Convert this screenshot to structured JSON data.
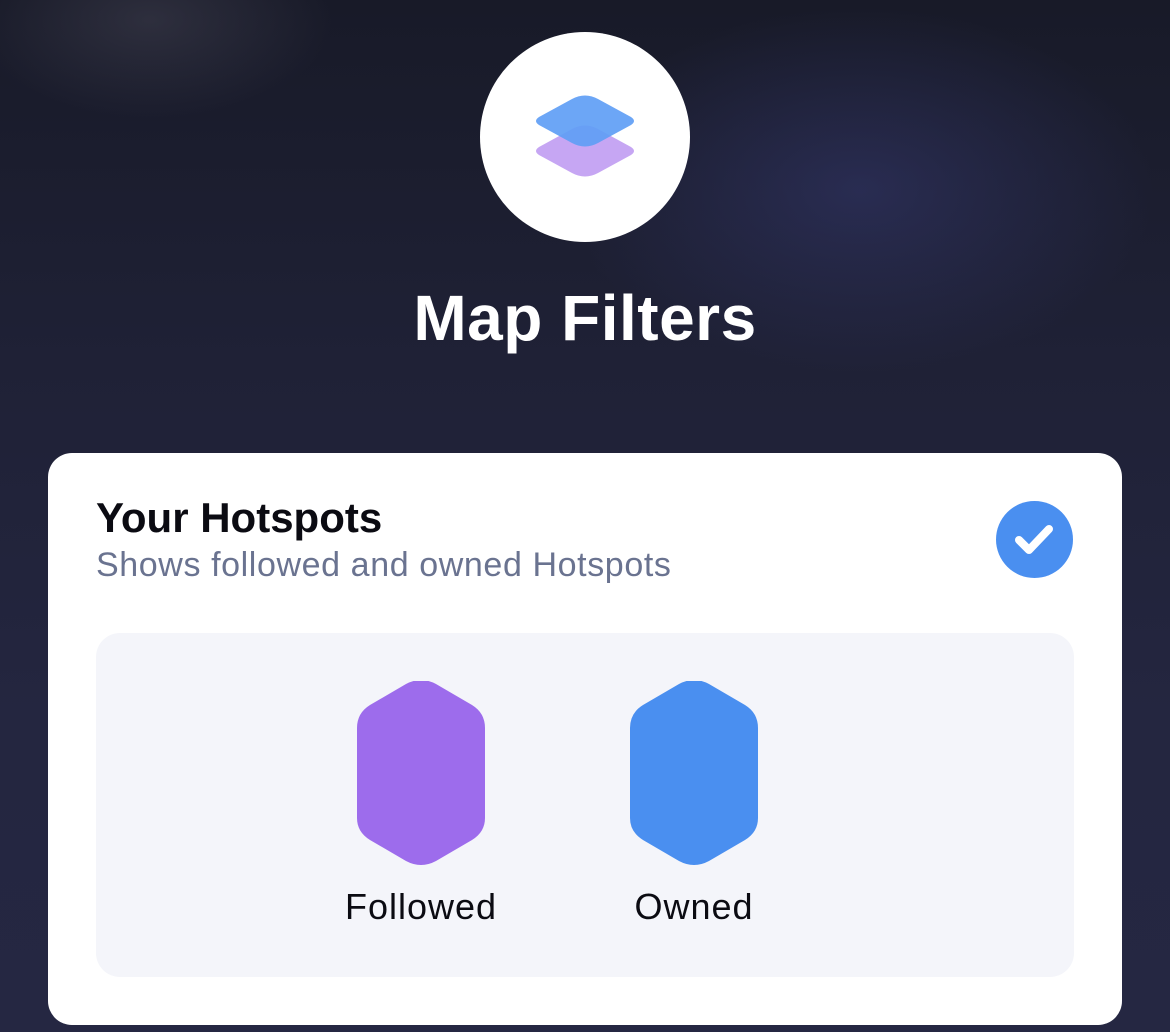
{
  "header": {
    "icon": "layers-icon",
    "title": "Map Filters"
  },
  "filter": {
    "title": "Your Hotspots",
    "subtitle": "Shows followed and owned Hotspots",
    "checked": true,
    "check_icon": "checkmark-icon",
    "legend": [
      {
        "label": "Followed",
        "icon": "hexagon-icon",
        "color": "#9d6cec"
      },
      {
        "label": "Owned",
        "icon": "hexagon-icon",
        "color": "#4a8ff0"
      }
    ]
  },
  "colors": {
    "accent_blue": "#4a8ff0",
    "accent_purple": "#9d6cec",
    "layer_top": "#5f9ef5",
    "layer_bottom": "#c6a6f3",
    "subtitle_gray": "#6a7390"
  }
}
